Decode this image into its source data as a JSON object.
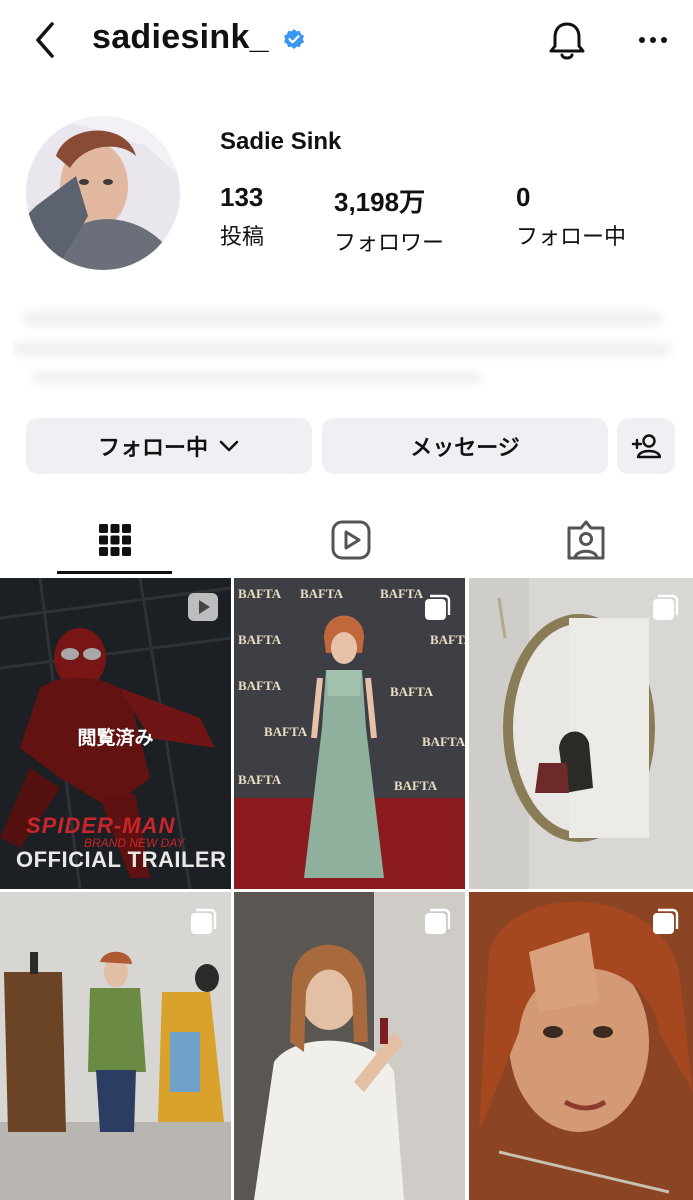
{
  "header": {
    "username": "sadiesink_",
    "icons": {
      "back": "chevron-left-icon",
      "verified": "verified-badge-icon",
      "notifications": "bell-icon",
      "more": "ellipsis-icon"
    },
    "accent": "#3897f0"
  },
  "profile": {
    "display_name": "Sadie Sink",
    "stats": [
      {
        "value": "133",
        "label": "投稿"
      },
      {
        "value": "3,198万",
        "label": "フォロワー"
      },
      {
        "value": "0",
        "label": "フォロー中"
      }
    ]
  },
  "actions": {
    "following_label": "フォロー中",
    "message_label": "メッセージ",
    "icons": {
      "following_dropdown": "chevron-down-icon",
      "suggest": "add-person-icon"
    }
  },
  "tabs": [
    {
      "name": "posts",
      "icon": "grid-icon",
      "active": true
    },
    {
      "name": "reels",
      "icon": "reels-icon",
      "active": false
    },
    {
      "name": "tagged",
      "icon": "tagged-icon",
      "active": false
    }
  ],
  "grid": {
    "seen_label": "閲覧済み",
    "trailer": {
      "title": "SPIDER-MAN",
      "subtitle": "BRAND NEW DAY",
      "caption": "OFFICIAL TRAILER"
    },
    "bafta_text": "BAFTA",
    "badges": {
      "video": "video-icon",
      "carousel": "carousel-icon"
    }
  }
}
